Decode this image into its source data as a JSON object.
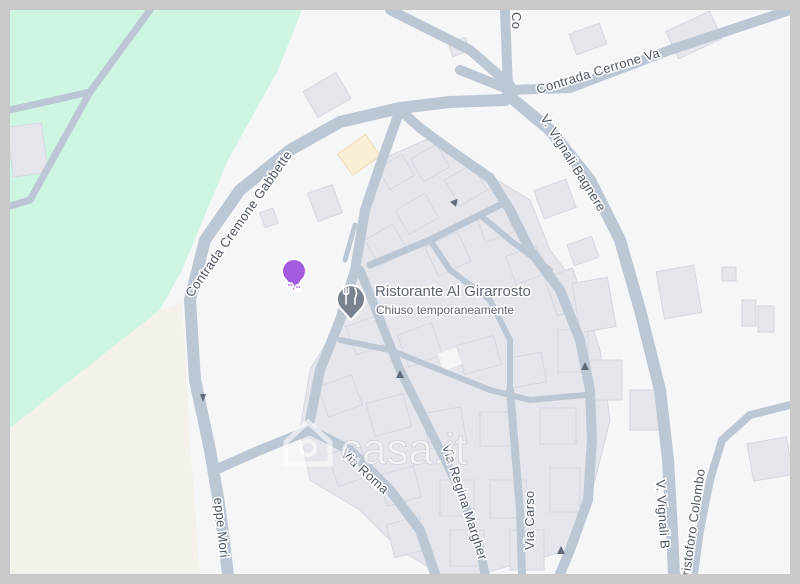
{
  "map": {
    "colors": {
      "background": "#f5f6f8",
      "park": "#cdf5e2",
      "sand": "#f3f1ea",
      "road": "#bcc7d6",
      "building": "#e4e6ec",
      "poi_purple": "#a55be0",
      "poi_gray": "#7a8290",
      "highlight_building": "#fbeed6"
    },
    "roads": {
      "contrada_cremone_gabbette": "Contrada Cremone Gabbette",
      "contrada_cerrone": "Contrada Cerrone Va",
      "co_top": "Co",
      "v_vignali_bagnere": "V. Vignali Bagnere",
      "v_vignali_b": "V. Vignali B",
      "cristoforo_colombo": "ristoforo Colombo",
      "via_roma": "Via Roma",
      "via_regina_margherita": "Via Regina Margher",
      "via_carso": "Via Carso",
      "giuseppe_mori": "eppe Mori"
    },
    "pois": {
      "restaurant": {
        "name": "Ristorante Al Girarrosto",
        "status": "Chiuso temporaneamente",
        "icon": "fork-knife-icon"
      },
      "theater": {
        "icon": "theater-masks-icon"
      }
    },
    "watermark": {
      "text": "casa.it",
      "icon": "casa-house-logo"
    }
  }
}
